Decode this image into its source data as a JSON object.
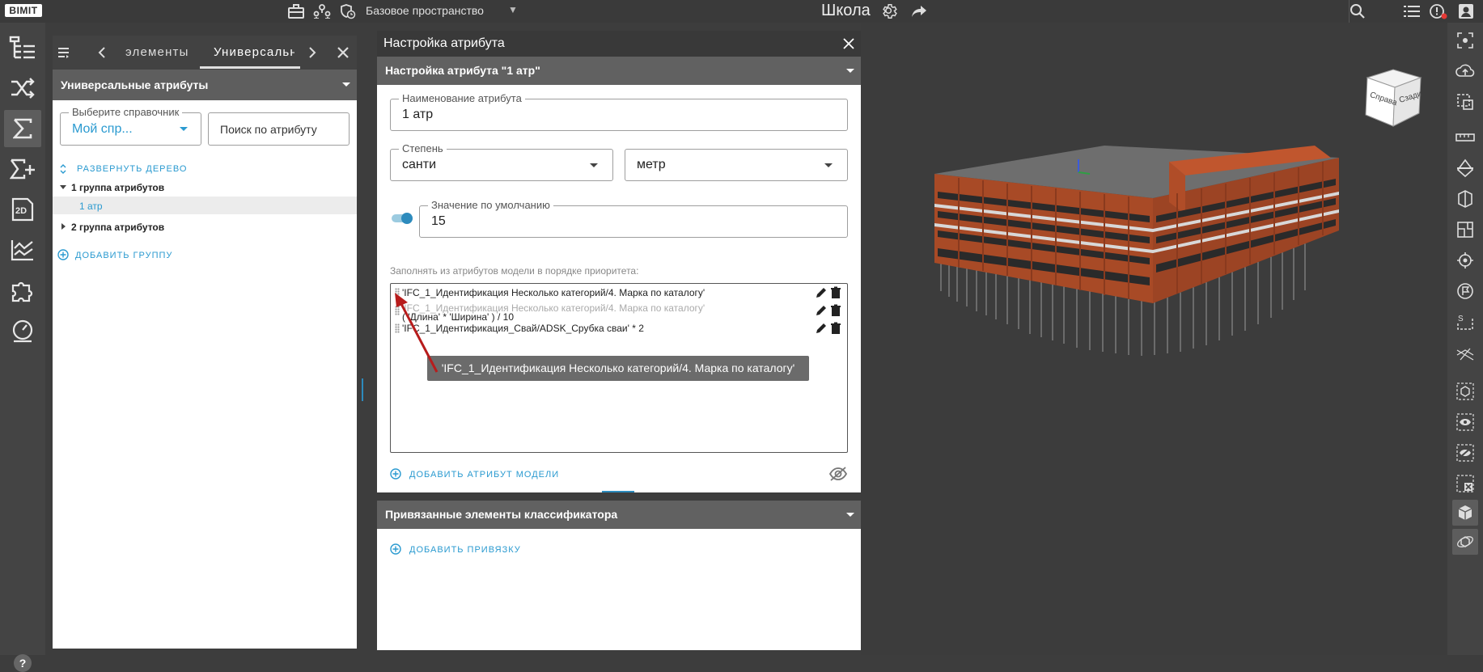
{
  "topbar": {
    "logo_text": "BIMIT",
    "workspace": "Базовое пространство",
    "project_title": "Школа"
  },
  "left_panel": {
    "tab_prev": "элементы",
    "tab_active": "Универсальные",
    "header": "Универсальные атрибуты",
    "dictionary": {
      "label": "Выберите справочник",
      "value": "Мой спр..."
    },
    "search": {
      "placeholder": "Поиск по атрибуту"
    },
    "expand_tree": "РАЗВЕРНУТЬ ДЕРЕВО",
    "tree": [
      {
        "label": "1 группа атрибутов",
        "expanded": true,
        "children": [
          {
            "label": "1 атр",
            "selected": true
          }
        ]
      },
      {
        "label": "2 группа атрибутов",
        "expanded": false,
        "children": []
      }
    ],
    "add_group": "ДОБАВИТЬ ГРУППУ"
  },
  "dialog": {
    "title": "Настройка атрибута",
    "section_title": "Настройка атрибута \"1 атр\"",
    "name_field": {
      "label": "Наименование атрибута",
      "value": "1 атр"
    },
    "degree_field": {
      "label": "Степень",
      "value": "санти"
    },
    "unit_field": {
      "value": "метр"
    },
    "default_toggle": {
      "on": true
    },
    "default_field": {
      "label": "Значение по умолчанию",
      "value": "15"
    },
    "fill_label": "Заполнять из атрибутов модели в порядке приоритета:",
    "attributes": [
      "'IFC_1_Идентификация Несколько категорий/4. Марка по каталогу'",
      "( 'Длина' * 'Ширина' ) / 10",
      "'IFC_1_Идентификация_Свай/ADSK_Срубка сваи' * 2"
    ],
    "ghost_row": "'IFC_1_Идентификация Несколько категорий/4. Марка по каталогу'",
    "tooltip": "'IFC_1_Идентификация Несколько категорий/4. Марка по каталогу'",
    "add_model_attr": "ДОБАВИТЬ АТРИБУТ МОДЕЛИ",
    "linked_section_title": "Привязанные элементы классификатора",
    "add_binding": "ДОБАВИТЬ ПРИВЯЗКУ"
  },
  "viewport": {
    "navcube_faces": [
      "Справа",
      "Сзади"
    ]
  },
  "help": "?",
  "colors": {
    "accent": "#2d8bbd",
    "brick": "#b5522c",
    "panel_dark": "#424242"
  }
}
